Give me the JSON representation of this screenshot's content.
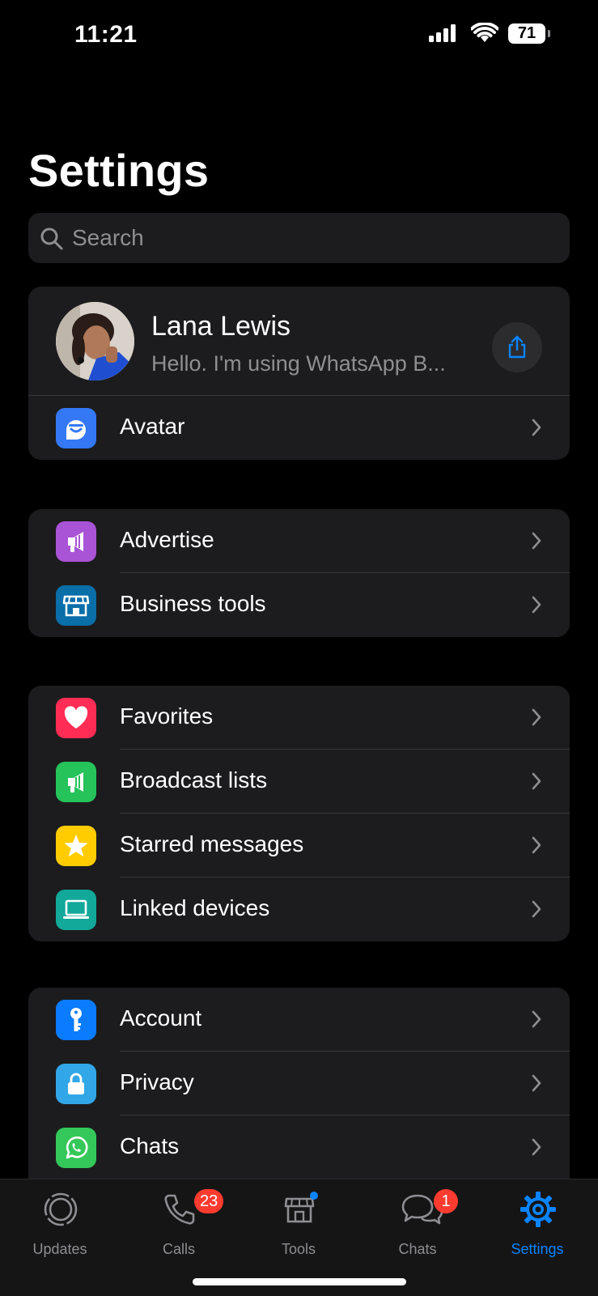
{
  "status_bar": {
    "time": "11:21",
    "battery": "71"
  },
  "page_title": "Settings",
  "search": {
    "placeholder": "Search"
  },
  "profile": {
    "name": "Lana Lewis",
    "status": "Hello. I'm using WhatsApp B..."
  },
  "group0": [
    {
      "label": "Avatar",
      "icon": "avatar-icon",
      "color": "#3478f6"
    }
  ],
  "group1": [
    {
      "label": "Advertise",
      "icon": "megaphone-icon",
      "color": "#a953d6"
    },
    {
      "label": "Business tools",
      "icon": "storefront-icon",
      "color": "#0a6ea8"
    }
  ],
  "group2": [
    {
      "label": "Favorites",
      "icon": "heart-icon",
      "color": "#ff2d55"
    },
    {
      "label": "Broadcast lists",
      "icon": "megaphone-icon",
      "color": "#25c35a"
    },
    {
      "label": "Starred messages",
      "icon": "star-icon",
      "color": "#ffcc00"
    },
    {
      "label": "Linked devices",
      "icon": "laptop-icon",
      "color": "#12a89a"
    }
  ],
  "group3": [
    {
      "label": "Account",
      "icon": "key-icon",
      "color": "#0a7cff"
    },
    {
      "label": "Privacy",
      "icon": "lock-icon",
      "color": "#32a7e8"
    },
    {
      "label": "Chats",
      "icon": "whatsapp-icon",
      "color": "#34c759"
    }
  ],
  "tabs": [
    {
      "label": "Updates",
      "icon": "updates-icon"
    },
    {
      "label": "Calls",
      "icon": "phone-icon",
      "badge": "23"
    },
    {
      "label": "Tools",
      "icon": "storefront-icon"
    },
    {
      "label": "Chats",
      "icon": "chat-bubbles-icon",
      "badge": "1"
    },
    {
      "label": "Settings",
      "icon": "gear-icon",
      "active": true
    }
  ],
  "colors": {
    "accent": "#0a84ff",
    "badge": "#ff3b30",
    "background": "#000000",
    "card": "#1c1c1e"
  }
}
